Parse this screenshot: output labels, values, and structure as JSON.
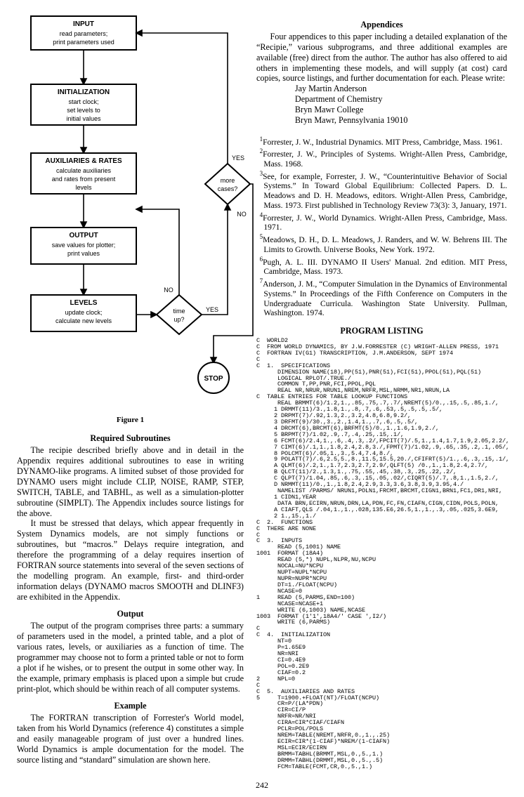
{
  "flow": {
    "input": {
      "title": "INPUT",
      "l1": "read parameters;",
      "l2": "print parameters used"
    },
    "init": {
      "title": "INITIALIZATION",
      "l1": "start clock;",
      "l2": "set levels to",
      "l3": "initial values"
    },
    "aux": {
      "title": "AUXILIARIES & RATES",
      "l1": "calculate auxiliaries",
      "l2": "and rates from present",
      "l3": "levels"
    },
    "out": {
      "title": "OUTPUT",
      "l1": "save values for plotter;",
      "l2": "print values"
    },
    "lev": {
      "title": "LEVELS",
      "l1": "update clock;",
      "l2": "calculate new levels"
    },
    "more": {
      "l1": "more",
      "l2": "cases?"
    },
    "time": {
      "l1": "time",
      "l2": "up?"
    },
    "stop": "STOP",
    "yes": "YES",
    "no": "NO"
  },
  "figcaption": "Figure 1",
  "left": {
    "reqsub_title": "Required Subroutines",
    "reqsub_p1": "The recipie described briefly above and in detail in the Appendix requires additional subroutines to ease in writing DYNAMO-like programs. A limited subset of those provided for DYNAMO users might include CLIP, NOISE, RAMP, STEP, SWITCH, TABLE, and TABHL, as well as a simulation-plotter subroutine (SIMPLT). The Appendix includes source listings for the above.",
    "reqsub_p2": "It must be stressed that delays, which appear frequently in System Dynamics models, are not simply functions or subroutines, but “macros.” Delays require integration, and therefore the programming of a delay requires insertion of FORTRAN source statements into several of the seven sections of the modelling program. An example, first- and third-order information delays (DYNAMO macros SMOOTH and DLINF3) are exhibited in the Appendix.",
    "output_title": "Output",
    "output_p": "The output of the program comprises three parts: a summary of parameters used in the model, a printed table, and a plot of various rates, levels, or auxiliaries as a function of time. The programmer may choose not to form a printed table or not to form a plot if he wishes, or to present the output in some other way. In the example, primary emphasis is placed upon a simple but crude print-plot, which should be within reach of all computer systems.",
    "example_title": "Example",
    "example_p": "The FORTRAN transcription of Forrester's World model, taken from his World Dynamics (reference 4) constitutes a simple and easily manageable program of just over a hundred lines. World Dynamics is ample documentation for the model. The source listing and “standard” simulation are shown here."
  },
  "right": {
    "appendices_title": "Appendices",
    "appendices_p1": "Four appendices to this paper including a detailed explanation of the “Recipie,” various subprograms, and three additional examples are available (free) direct from the author. The author has also offered to aid others in implementing these models, and will supply (at cost) card copies, source listings, and further documentation for each. Please write:",
    "addr1": "Jay Martin Anderson",
    "addr2": "Department of Chemistry",
    "addr3": "Bryn Mawr College",
    "addr4": "Bryn Mawr, Pennsylvania 19010",
    "ref1": "Forrester, J. W., Industrial Dynamics. MIT Press, Cambridge, Mass. 1961.",
    "ref2": "Forrester, J. W., Principles of Systems. Wright-Allen Press, Cambridge, Mass. 1968.",
    "ref3": "See, for example, Forrester, J. W., “Counterintuitive Behavior of Social Systems.” In Toward Global Equilibrium: Collected Papers. D. L. Meadows and D. H. Meadows, editors. Wright-Allen Press, Cambridge, Mass. 1973. First published in Technology Review 73(3): 3, January, 1971.",
    "ref4": "Forrester, J. W., World Dynamics. Wright-Allen Press, Cambridge, Mass. 1971.",
    "ref5": "Meadows, D. H., D. L. Meadows, J. Randers, and W. W. Behrens III. The Limits to Growth. Universe Books, New York. 1972.",
    "ref6": "Pugh, A. L. III. DYNAMO II Users' Manual. 2nd edition. MIT Press, Cambridge, Mass. 1973.",
    "ref7": "Anderson, J. M., “Computer Simulation in the Dynamics of Environmental Systems.” In Proceedings of the Fifth Conference on Computers in the Undergraduate Curricula. Washington State University. Pullman, Washington. 1974.",
    "prog_title": "PROGRAM LISTING",
    "code": "C  WORLD2\nC  FROM WORLD DYNAMICS, BY J.W.FORRESTER (C) WRIGHT-ALLEN PRESS, 1971\nC  FORTRAN IV(G1) TRANSCRIPTION, J.M.ANDERSON, SEPT 1974\nC\nC  1.  SPECIFICATIONS\n      DIMENSION NAME(18),PP(51),PNR(51),FCI(51),PPOL(51),PQL(51)\n      LOGICAL RPLOT/.TRUE./\n      COMMON T,PP,PNR,FCI,PPOL,PQL\n      REAL NR,NRUR,NRUN1,NREM,NRFR,MSL,NRMM,NR1,NRUN,LA\nC  TABLE ENTRIES FOR TABLE LOOKUP FUNCTIONS\n      REAL BRMMT(6)/1.2,1.,.85,.75,.7,.7/,NREMT(5)/0.,.15,.5,.85,1./,\n     1 DRMMT(11)/3.,1.8,1.,.8,.7,.6,.53,.5,.5,.5,.5/,\n     2 DRPMT(7)/.92,1.3,2.,3.2,4.8,6.8,9.2/,\n     3 DRFMT(9)/30.,3.,2.,1.4,1.,.7,.6,.5,.5/,\n     4 DRCMT(6),BRCMT(6),BRFMT(5)/0.,1.,1.6,1.9,2./,\n     5 BRPMT(7)/1.02,.9,.7,.4,.25,.15,.1/,\n     6 FCMT(6)/2.4,1.,.6,.4,.3,.2/,FPCIT(7)/.5,1.,1.4,1.7,1.9,2.05,2.2/,\n     7 CIMT(6)/.1,1.,1.8,2.4,2.8,3./,FPMT(7)/1.02,.9,.65,.35,.2,.1,.05/,\n     8 POLCMT(6)/.05,1.,3.,5.4,7.4,8./,\n     9 POLATT(7)/.6,2.5,5.,8.,11.5,15.5,20./,CFIFRT(5)/1.,.6,.3,.15,.1/,\n     A QLMT(6)/.2,1.,1.7,2.3,2.7,2.9/,QLFT(5) /0.,1.,1.8,2.4,2.7/,\n     B QLCT(11)/2.,1.3,1.,.75,.55,.45,.38,.3,.25,.22,.2/,\n     C QLPT(7)/1.04,.85,.6,.3,.15,.05,.02/,CIQRT(5)/.7,.8,1.,1.5,2./,\n     D NRMMT(11)/0.,1.,1.8,2.4,2.9,3.3,3.6,3.8,3.9,3.95,4./\n      NAMELIST /PARMS/ NRUN1,POLN1,FRCMT,BRCMT,CIGN1,BRN1,FC1,DR1,NRI,\n     1 CIDN1,YEAR\n      DATA BRN,ECIRN,NRUN,DRN,LA,PDN,FC,FN,CIAFN,CIGN,CIDN,POLS,POLN,\n     A CIAFT,QLS /.04,1.,1.,.028,135.E6,26.5,1.,1.,.3,.05,.025,3.6E9,\n     2 1.,15.,1./\nC  2.  FUNCTIONS\nC  THERE ARE NONE\nC\nC  3.  INPUTS\n      READ (5,1001) NAME\n1001  FORMAT (18A4)\n      READ (5,*) NUPL,NLPR,NU,NCPU\n      NOCAL=NU*NCPU\n      NUPT=NUPL*NCPU\n      NUPR=NUPR*NCPU\n      DT=1./FLOAT(NCPU)\n      NCASE=0\n1     READ (5,PARMS,END=100)\n      NCASE=NCASE+1\n      WRITE (6,1003) NAME,NCASE\n1003  FORMAT (1'1',18A4/' CASE ',I2/)\n      WRITE (6,PARMS)\nC\nC  4.  INITIALIZATION\n      NT=0\n      P=1.65E9\n      NR=NRI\n      CI=0.4E9\n      POL=0.2E9\n      CIAF=0.2\n2     NPL=0\nC\nC  5.  AUXILIARIES AND RATES\n5     T=1900.+FLOAT(NT)/FLOAT(NCPU)\n      CR=P/(LA*PDN)\n      CIR=CI/P\n      NRFR=NR/NRI\n      CIRA=CIR*CIAF/CIAFN\n      PCLR=POL/POLS\n      NREM=TABLE(NREMT,NRFR,0.,1.,.25)\n      ECIR=CIR*(1-CIAF)*NREM/(1-CIAFN)\n      MSL=ECIR/ECIRN\n      BRMM=TABHL(BRMMT,MSL,0.,5.,1.)\n      DRMM=TABHL(DRMMT,MSL,0.,5.,.5)\n      FCM=TABLE(FCMT,CR,0.,5.,1.)"
  },
  "pagenum": "242"
}
